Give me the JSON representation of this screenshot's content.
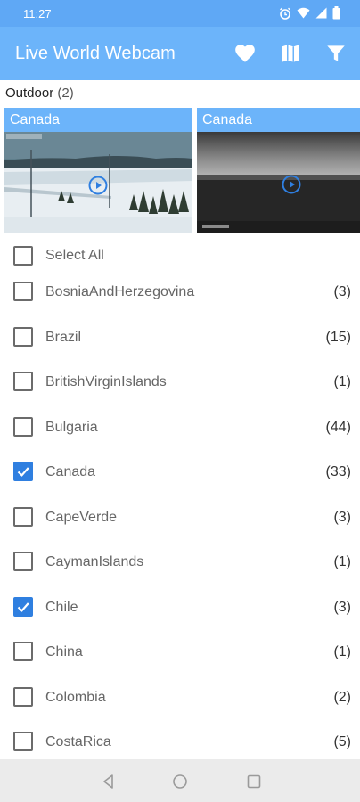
{
  "status_bar": {
    "time": "11:27"
  },
  "app_bar": {
    "title": "Live World Webcam",
    "actions": [
      "favorite-icon",
      "map-icon",
      "filter-icon"
    ]
  },
  "section": {
    "label": "Outdoor",
    "count": "(2)"
  },
  "cards": [
    {
      "title": "Canada",
      "icon": "play-icon"
    },
    {
      "title": "Canada",
      "icon": "play-icon"
    }
  ],
  "select_all": {
    "label": "Select All",
    "checked": false
  },
  "countries": [
    {
      "name": "BosniaAndHerzegovina",
      "count": "(3)",
      "checked": false
    },
    {
      "name": "Brazil",
      "count": "(15)",
      "checked": false
    },
    {
      "name": "BritishVirginIslands",
      "count": "(1)",
      "checked": false
    },
    {
      "name": "Bulgaria",
      "count": "(44)",
      "checked": false
    },
    {
      "name": "Canada",
      "count": "(33)",
      "checked": true
    },
    {
      "name": "CapeVerde",
      "count": "(3)",
      "checked": false
    },
    {
      "name": "CaymanIslands",
      "count": "(1)",
      "checked": false
    },
    {
      "name": "Chile",
      "count": "(3)",
      "checked": true
    },
    {
      "name": "China",
      "count": "(1)",
      "checked": false
    },
    {
      "name": "Colombia",
      "count": "(2)",
      "checked": false
    },
    {
      "name": "CostaRica",
      "count": "(5)",
      "checked": false
    }
  ],
  "nav_bar": {
    "buttons": [
      "back-icon",
      "home-icon",
      "recents-icon"
    ]
  },
  "colors": {
    "status_bar": "#5fa8f5",
    "app_bar": "#6cb4fa",
    "checkbox_checked": "#2f7fe0"
  }
}
